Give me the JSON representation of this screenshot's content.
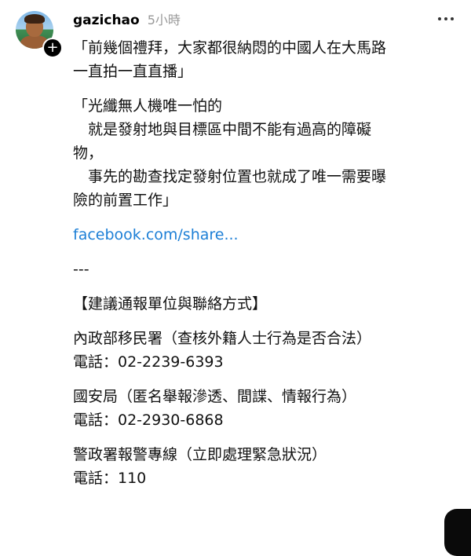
{
  "post": {
    "author": "gazichao",
    "time": "5小時",
    "paragraphs": [
      "「前幾個禮拜，大家都很納悶的中國人在大馬路\n一直拍一直直播」",
      "「光纖無人機唯一怕的\n　就是發射地與目標區中間不能有過高的障礙\n物，\n　事先的勘查找定發射位置也就成了唯一需要曝\n險的前置工作」"
    ],
    "link_text": "facebook.com/share...",
    "separator": "---",
    "section_title": "【建議通報單位與聯絡方式】",
    "contacts": [
      {
        "line1": "內政部移民署（查核外籍人士行為是否合法）",
        "line2": "電話：02-2239-6393"
      },
      {
        "line1": "國安局（匿名舉報滲透、間諜、情報行為）",
        "line2": "電話：02-2930-6868"
      },
      {
        "line1": "警政署報警專線（立即處理緊急狀況）",
        "line2": "電話：110"
      }
    ]
  },
  "icons": {
    "avatar": "user-avatar",
    "follow": "plus-icon",
    "more": "more-horizontal-icon"
  }
}
